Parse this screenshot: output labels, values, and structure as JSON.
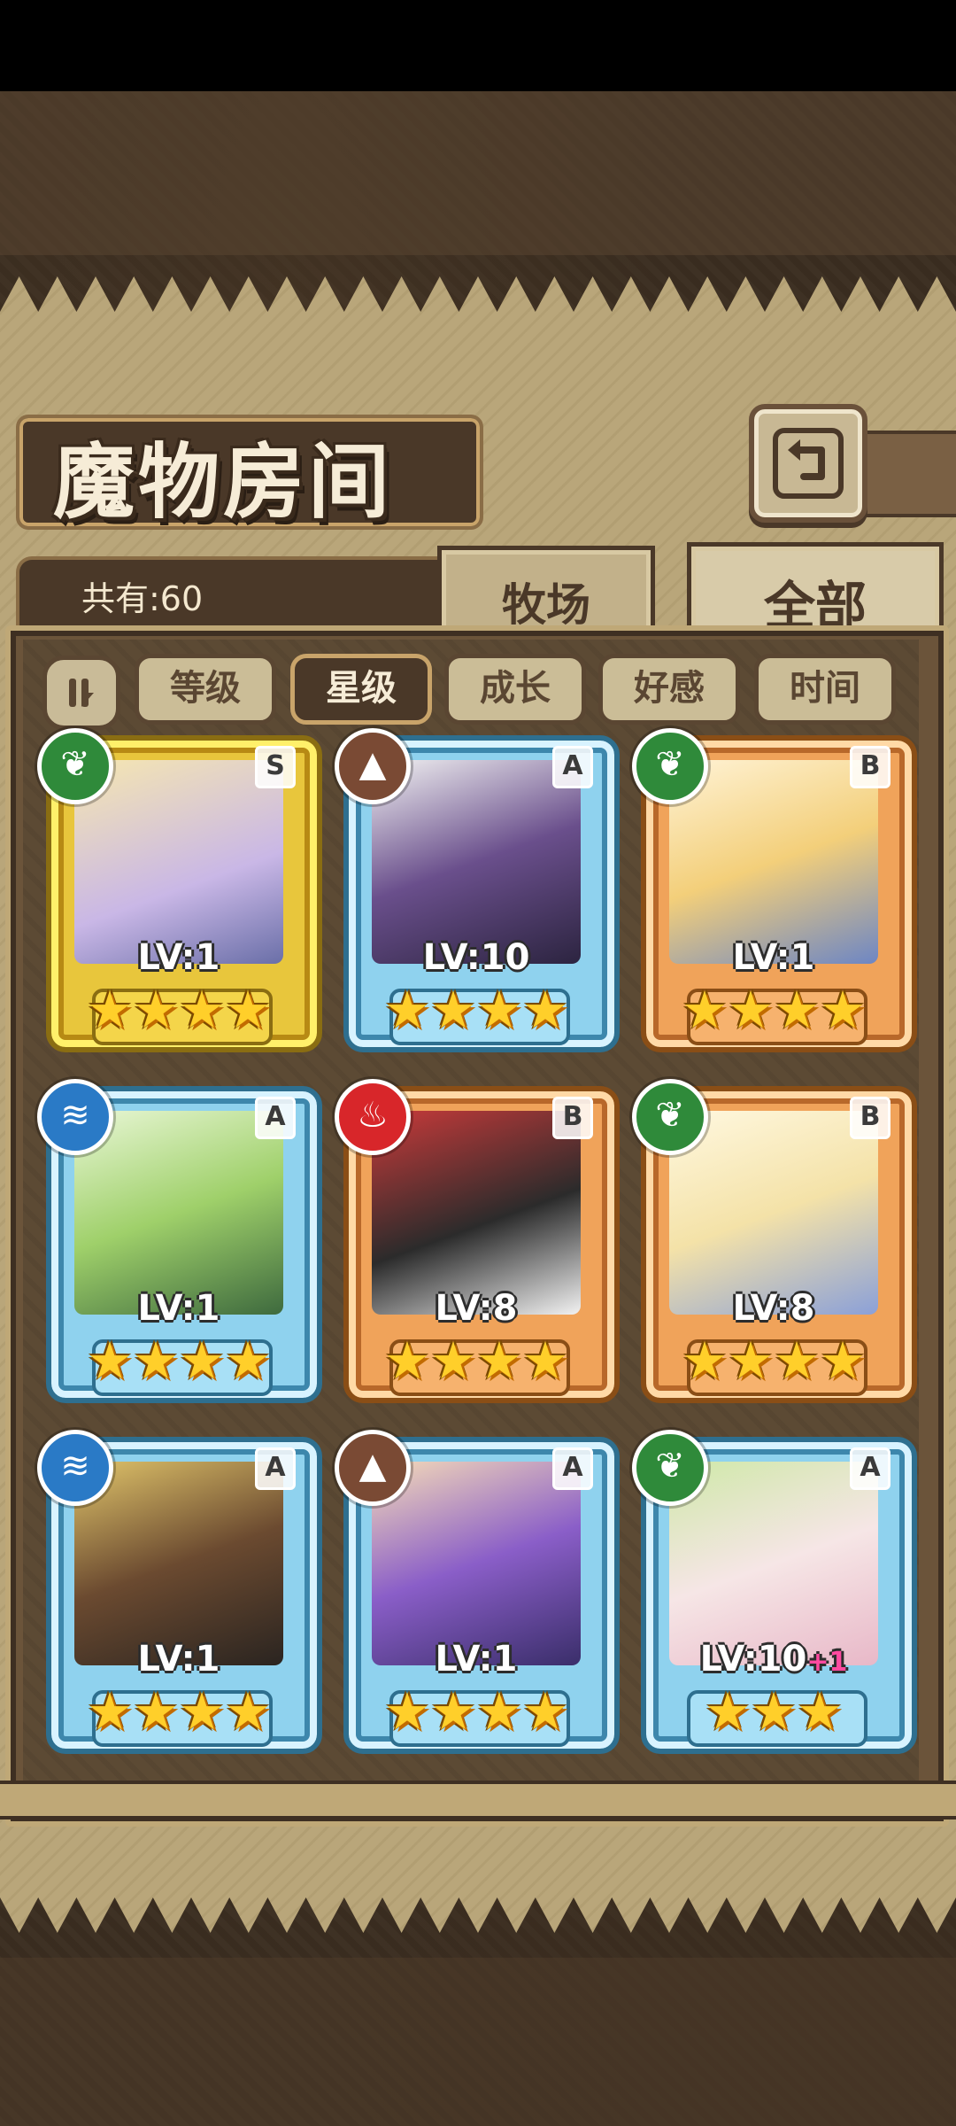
{
  "header": {
    "title": "魔物房间",
    "count_label": "共有:60"
  },
  "tabs": [
    {
      "label": "牧场"
    },
    {
      "label": "全部"
    }
  ],
  "sort": {
    "buttons": [
      {
        "label": "等级"
      },
      {
        "label": "星级"
      },
      {
        "label": "成长"
      },
      {
        "label": "好感"
      },
      {
        "label": "时间"
      }
    ],
    "active": "星级"
  },
  "monsters": [
    {
      "grade": "S",
      "element": "plant-icon",
      "level": "LV:1",
      "bonus": "",
      "stars": "★★★★",
      "frame": "gold"
    },
    {
      "grade": "A",
      "element": "earth-icon",
      "level": "LV:10",
      "bonus": "",
      "stars": "★★★★",
      "frame": "blue"
    },
    {
      "grade": "B",
      "element": "plant-icon",
      "level": "LV:1",
      "bonus": "",
      "stars": "★★★★",
      "frame": "orange"
    },
    {
      "grade": "A",
      "element": "water-icon",
      "level": "LV:1",
      "bonus": "",
      "stars": "★★★★",
      "frame": "blue"
    },
    {
      "grade": "B",
      "element": "fire-icon",
      "level": "LV:8",
      "bonus": "",
      "stars": "★★★★",
      "frame": "orange"
    },
    {
      "grade": "B",
      "element": "plant-icon",
      "level": "LV:8",
      "bonus": "",
      "stars": "★★★★",
      "frame": "orange"
    },
    {
      "grade": "A",
      "element": "water-icon",
      "level": "LV:1",
      "bonus": "",
      "stars": "★★★★",
      "frame": "blue"
    },
    {
      "grade": "A",
      "element": "earth-icon",
      "level": "LV:1",
      "bonus": "",
      "stars": "★★★★",
      "frame": "blue"
    },
    {
      "grade": "A",
      "element": "plant-icon",
      "level": "LV:10",
      "bonus": "+1",
      "stars": "★★★",
      "frame": "blue"
    }
  ],
  "colors": {
    "parchment": "#b9a67a",
    "panel": "#6b543a",
    "gold_frame": "#e8c63c",
    "blue_frame": "#8fd2ee",
    "orange_frame": "#f0a35a",
    "star": "#ffcf2a"
  }
}
